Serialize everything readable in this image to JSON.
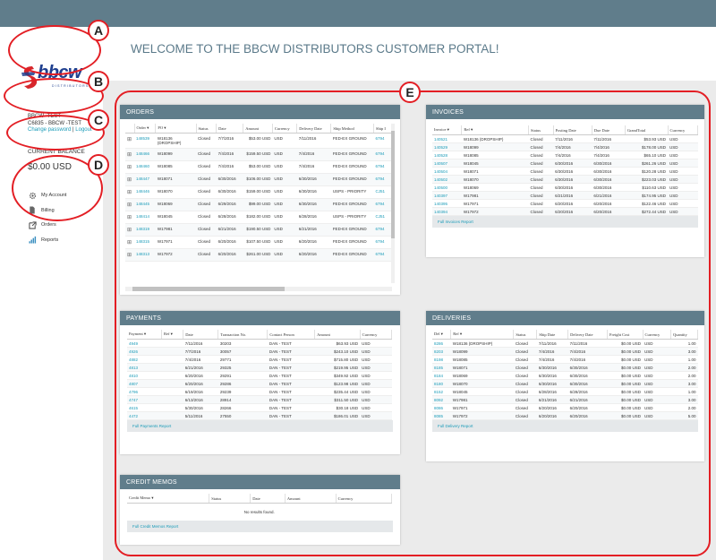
{
  "welcome": "WELCOME TO THE BBCW DISTRIBUTORS CUSTOMER PORTAL!",
  "logo": {
    "text": "bbcw",
    "sub": "DISTRIBUTORS"
  },
  "account": {
    "name": "BBCW -TEST",
    "code": "C6835 - BBCW -TEST",
    "change_password": "Change password",
    "sep": " | ",
    "logout": "Logout"
  },
  "balance": {
    "label": "CURRENT BALANCE",
    "value": "$0.00 USD"
  },
  "nav": [
    {
      "label": "My Account",
      "icon": "gear-icon"
    },
    {
      "label": "Billing",
      "icon": "document-icon"
    },
    {
      "label": "Orders",
      "icon": "external-link-icon"
    },
    {
      "label": "Reports",
      "icon": "bar-chart-icon"
    }
  ],
  "callouts": [
    "A",
    "B",
    "C",
    "D",
    "E"
  ],
  "orders": {
    "title": "ORDERS",
    "columns": [
      "",
      "Order ▾",
      "PO ▾",
      "Status",
      "Date",
      "Amount",
      "Currency",
      "Delivery Date",
      "Ship Method",
      "Ship I"
    ],
    "rows": [
      [
        "⊞",
        "148539",
        "W18136 (DROPSHIP)",
        "Closed",
        "7/7/2016",
        "$53.00 USD",
        "USD",
        "7/11/2016",
        "FED-EX GROUND",
        "6794"
      ],
      [
        "⊞",
        "148466",
        "W18099",
        "Closed",
        "7/4/2016",
        "$159.50 USD",
        "USD",
        "7/4/2016",
        "FED-EX GROUND",
        "6794"
      ],
      [
        "⊞",
        "148460",
        "W18085",
        "Closed",
        "7/4/2016",
        "$53.00 USD",
        "USD",
        "7/4/2016",
        "FED-EX GROUND",
        "6794"
      ],
      [
        "⊞",
        "148447",
        "W18071",
        "Closed",
        "6/30/2016",
        "$106.00 USD",
        "USD",
        "6/30/2016",
        "FED-EX GROUND",
        "6794"
      ],
      [
        "⊞",
        "148446",
        "W18070",
        "Closed",
        "6/30/2016",
        "$159.00 USD",
        "USD",
        "6/30/2016",
        "USPS - PRIORITY",
        "CJ51"
      ],
      [
        "⊞",
        "148445",
        "W18069",
        "Closed",
        "6/29/2016",
        "$99.00 USD",
        "USD",
        "6/30/2016",
        "FED-EX GROUND",
        "6794"
      ],
      [
        "⊞",
        "148414",
        "W18045",
        "Closed",
        "6/28/2016",
        "$182.00 USD",
        "USD",
        "6/28/2016",
        "USPS - PRIORITY",
        "CJ51"
      ],
      [
        "⊞",
        "148319",
        "W17981",
        "Closed",
        "6/21/2016",
        "$190.50 USD",
        "USD",
        "6/21/2016",
        "FED-EX GROUND",
        "6794"
      ],
      [
        "⊞",
        "148315",
        "W17971",
        "Closed",
        "6/20/2016",
        "$107.50 USD",
        "USD",
        "6/20/2016",
        "FED-EX GROUND",
        "6794"
      ],
      [
        "⊞",
        "148313",
        "W17972",
        "Closed",
        "6/20/2016",
        "$261.00 USD",
        "USD",
        "6/20/2016",
        "FED-EX GROUND",
        "6794"
      ]
    ]
  },
  "invoices": {
    "title": "INVOICES",
    "columns": [
      "Invoice ▾",
      "Ref ▾",
      "Status",
      "Posting Date",
      "Due Date",
      "GrandTotal",
      "Currency"
    ],
    "rows": [
      [
        "140521",
        "W18136 (DROPSHIP)",
        "Closed",
        "7/11/2016",
        "7/11/2016",
        "$53.93 USD",
        "USD"
      ],
      [
        "140529",
        "W18099",
        "Closed",
        "7/4/2016",
        "7/4/2016",
        "$178.00 USD",
        "USD"
      ],
      [
        "140528",
        "W18085",
        "Closed",
        "7/4/2016",
        "7/4/2016",
        "$65.10 USD",
        "USD"
      ],
      [
        "140507",
        "W18045",
        "Closed",
        "6/30/2016",
        "6/30/2016",
        "$261.26 USD",
        "USD"
      ],
      [
        "140504",
        "W18071",
        "Closed",
        "6/30/2016",
        "6/30/2016",
        "$120.28 USD",
        "USD"
      ],
      [
        "140502",
        "W18070",
        "Closed",
        "6/30/2016",
        "6/30/2016",
        "$223.03 USD",
        "USD"
      ],
      [
        "140500",
        "W18069",
        "Closed",
        "6/30/2016",
        "6/30/2016",
        "$110.63 USD",
        "USD"
      ],
      [
        "140397",
        "W17981",
        "Closed",
        "6/21/2016",
        "6/21/2016",
        "$174.95 USD",
        "USD"
      ],
      [
        "140395",
        "W17971",
        "Closed",
        "6/20/2016",
        "6/20/2016",
        "$122.46 USD",
        "USD"
      ],
      [
        "140394",
        "W17972",
        "Closed",
        "6/20/2016",
        "6/20/2016",
        "$272.44 USD",
        "USD"
      ]
    ],
    "footer": "Full Invoices Report"
  },
  "payments": {
    "title": "PAYMENTS",
    "columns": [
      "Payment ▾",
      "Ref ▾",
      "Date",
      "Transaction No.",
      "Contact Person",
      "Amount",
      "Currency"
    ],
    "rows": [
      [
        "4949",
        "",
        "7/11/2016",
        "30203",
        "DAN - TEST",
        "$63.93 USD",
        "USD"
      ],
      [
        "4926",
        "",
        "7/7/2016",
        "30057",
        "DAN - TEST",
        "$243.10 USD",
        "USD"
      ],
      [
        "4882",
        "",
        "7/4/2016",
        "29771",
        "DAN - TEST",
        "$715.80 USD",
        "USD"
      ],
      [
        "4813",
        "",
        "6/21/2016",
        "29325",
        "DAN - TEST",
        "$219.95 USD",
        "USD"
      ],
      [
        "4810",
        "",
        "6/20/2016",
        "29291",
        "DAN - TEST",
        "$349.92 USD",
        "USD"
      ],
      [
        "4807",
        "",
        "6/20/2016",
        "29286",
        "DAN - TEST",
        "$123.98 USD",
        "USD"
      ],
      [
        "4796",
        "",
        "6/19/2016",
        "29239",
        "DAN - TEST",
        "$235.44 USD",
        "USD"
      ],
      [
        "4747",
        "",
        "6/13/2016",
        "28914",
        "DAN - TEST",
        "$311.50 USD",
        "USD"
      ],
      [
        "4615",
        "",
        "5/30/2016",
        "28266",
        "DAN - TEST",
        "$30.18 USD",
        "USD"
      ],
      [
        "4472",
        "",
        "5/11/2016",
        "27550",
        "DAN - TEST",
        "$186.01 USD",
        "USD"
      ]
    ],
    "footer": "Full Payments Report"
  },
  "deliveries": {
    "title": "DELIVERIES",
    "columns": [
      "Del ▾",
      "Ref ▾",
      "Status",
      "Ship Date",
      "Delivery Date",
      "Freight Cost",
      "Currency",
      "Quantity"
    ],
    "rows": [
      [
        "8286",
        "W18136 (DROPSHIP)",
        "Closed",
        "7/11/2016",
        "7/11/2016",
        "$0.00 USD",
        "USD",
        "1.00"
      ],
      [
        "8203",
        "W18099",
        "Closed",
        "7/4/2016",
        "7/4/2016",
        "$0.00 USD",
        "USD",
        "3.00"
      ],
      [
        "8198",
        "W18085",
        "Closed",
        "7/4/2016",
        "7/4/2016",
        "$0.00 USD",
        "USD",
        "1.00"
      ],
      [
        "8185",
        "W18071",
        "Closed",
        "6/30/2016",
        "6/30/2016",
        "$0.00 USD",
        "USD",
        "2.00"
      ],
      [
        "8184",
        "W18069",
        "Closed",
        "6/30/2016",
        "6/30/2016",
        "$0.00 USD",
        "USD",
        "2.00"
      ],
      [
        "8180",
        "W18070",
        "Closed",
        "6/30/2016",
        "6/30/2016",
        "$0.00 USD",
        "USD",
        "3.00"
      ],
      [
        "8152",
        "W18045",
        "Closed",
        "6/28/2016",
        "6/28/2016",
        "$0.00 USD",
        "USD",
        "1.00"
      ],
      [
        "8092",
        "W17981",
        "Closed",
        "6/21/2016",
        "6/21/2016",
        "$0.00 USD",
        "USD",
        "3.00"
      ],
      [
        "8086",
        "W17971",
        "Closed",
        "6/20/2016",
        "6/20/2016",
        "$0.00 USD",
        "USD",
        "2.00"
      ],
      [
        "8085",
        "W17972",
        "Closed",
        "6/20/2016",
        "6/20/2016",
        "$0.00 USD",
        "USD",
        "5.00"
      ]
    ],
    "footer": "Full Delivery Report"
  },
  "credit_memos": {
    "title": "CREDIT MEMOS",
    "columns": [
      "Credit Memo ▾",
      "Status",
      "Date",
      "Amount",
      "Currency"
    ],
    "empty": "No results found.",
    "footer": "Full Credit Memos Report"
  },
  "colors": {
    "header": "#607d8b",
    "link": "#1a9bb8",
    "callout": "#e31e24",
    "logo_blue": "#1f3f8f",
    "logo_red": "#d7262b"
  }
}
